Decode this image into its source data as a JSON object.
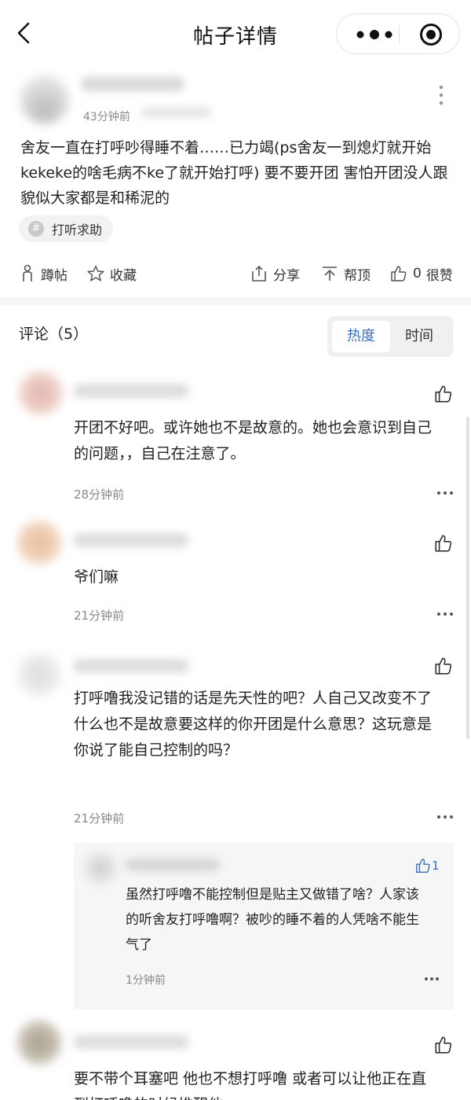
{
  "nav": {
    "title": "帖子详情"
  },
  "post": {
    "time": "43分钟前",
    "text": "舍友一直在打呼吵得睡不着……已力竭(ps舍友一到熄灯就开始kekeke的啥毛病不ke了就开始打呼) 要不要开团 害怕开团没人跟 貌似大家都是和稀泥的",
    "tag": "打听求助",
    "actions": {
      "squat": "蹲帖",
      "collect": "收藏",
      "share": "分享",
      "boost": "帮顶",
      "like_count": "0",
      "like_label": "很赞"
    }
  },
  "comments_header": {
    "label": "评论（5）",
    "sort_hot": "热度",
    "sort_time": "时间"
  },
  "comments": [
    {
      "text": "开团不好吧。或许她也不是故意的。她也会意识到自己的问题，，自己在注意了。",
      "time": "28分钟前"
    },
    {
      "text": "爷们嘛",
      "time": "21分钟前"
    },
    {
      "text": "打呼噜我没记错的话是先天性的吧？人自己又改变不了什么也不是故意要这样的你开团是什么意思？这玩意是你说了能自己控制的吗？",
      "time": "21分钟前"
    },
    {
      "text": "要不带个耳塞吧 他也不想打呼噜 或者可以让他正在直到打呼噜的时候推醒他",
      "time": ""
    }
  ],
  "reply": {
    "text": "虽然打呼噜不能控制但是贴主又做错了啥？人家该的听舍友打呼噜啊？被吵的睡不着的人凭啥不能生气了",
    "time": "1分钟前",
    "like_count": "1"
  },
  "colors": {
    "accent": "#3a6fb7",
    "muted": "#888888",
    "divider": "#f5f5f5"
  }
}
